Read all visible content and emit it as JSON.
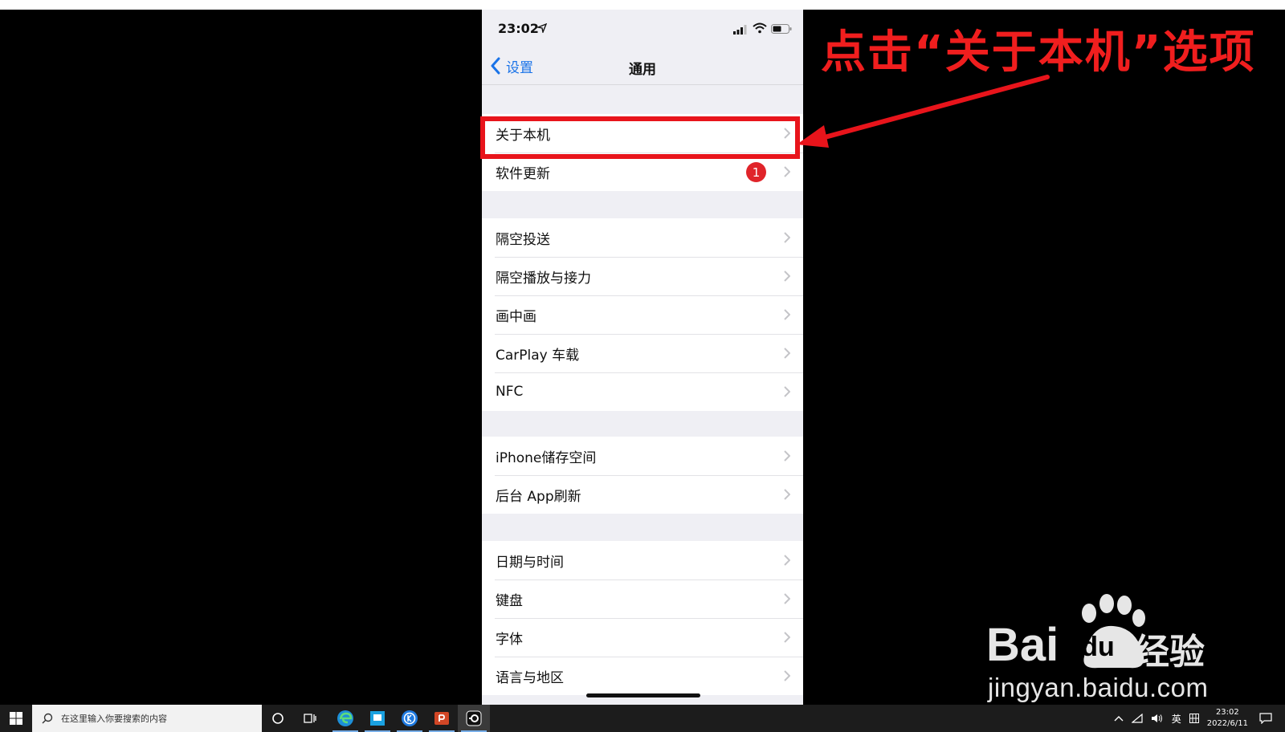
{
  "phone": {
    "status": {
      "time": "23:02"
    },
    "nav": {
      "back_label": "设置",
      "title": "通用"
    },
    "groups": [
      {
        "items": [
          {
            "label": "关于本机"
          },
          {
            "label": "软件更新",
            "badge": "1"
          }
        ]
      },
      {
        "items": [
          {
            "label": "隔空投送"
          },
          {
            "label": "隔空播放与接力"
          },
          {
            "label": "画中画"
          },
          {
            "label": "CarPlay 车载"
          },
          {
            "label": "NFC"
          }
        ]
      },
      {
        "items": [
          {
            "label": "iPhone储存空间"
          },
          {
            "label": "后台 App刷新"
          }
        ]
      },
      {
        "items": [
          {
            "label": "日期与时间"
          },
          {
            "label": "键盘"
          },
          {
            "label": "字体"
          },
          {
            "label": "语言与地区"
          }
        ]
      }
    ]
  },
  "annotation": {
    "callout": "点击“关于本机”选项",
    "color": "#e8141b"
  },
  "watermark": {
    "brand_latin": "Bai",
    "brand_du": "du",
    "brand_cn": "经验",
    "url": "jingyan.baidu.com"
  },
  "taskbar": {
    "search_placeholder": "在这里输入你要搜索的内容",
    "ime": "英",
    "clock_time": "23:02",
    "clock_date": "2022/6/11"
  }
}
